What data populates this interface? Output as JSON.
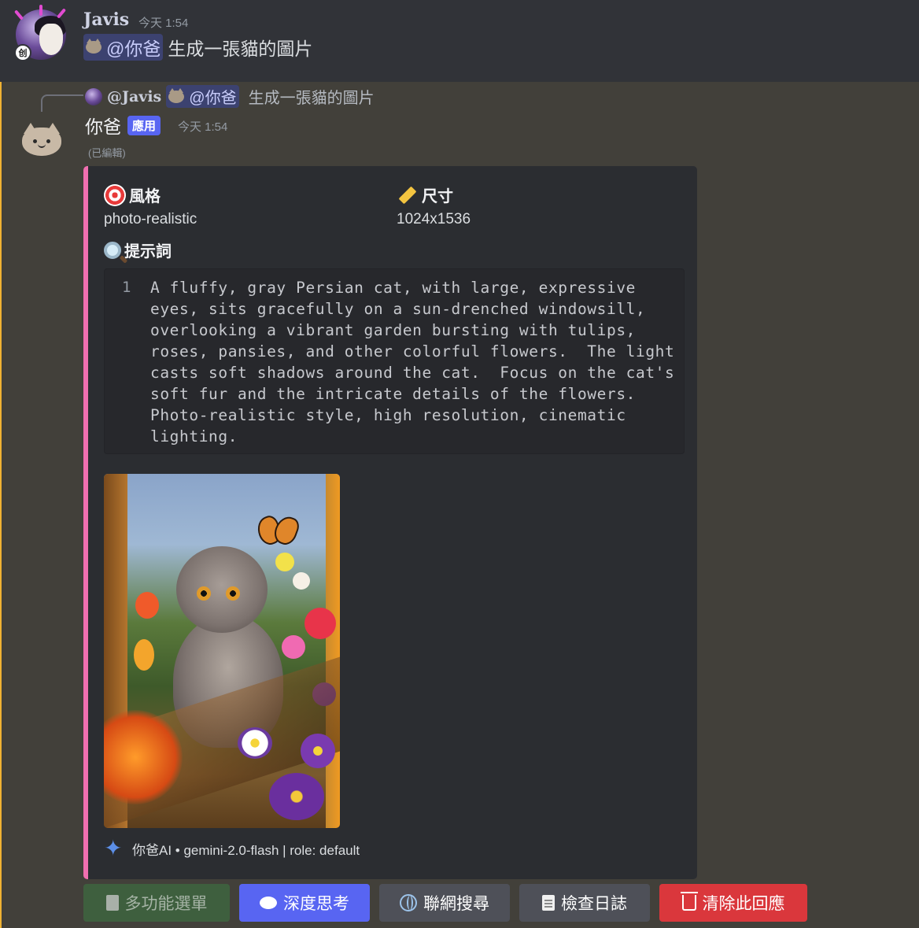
{
  "message1": {
    "author": "Javis",
    "timestamp": "今天 1:54",
    "mention": "@你爸",
    "text": "生成一張貓的圖片"
  },
  "message2": {
    "reply": {
      "author": "@Javis",
      "mention": "@你爸",
      "text": "生成一張貓的圖片"
    },
    "author": "你爸",
    "badge": "應用",
    "timestamp": "今天 1:54",
    "edited": "(已編輯)",
    "embed": {
      "accent_color": "#f06fb0",
      "fields": {
        "style_title": "風格",
        "style_value": "photo-realistic",
        "size_title": "尺寸",
        "size_value": "1024x1536",
        "prompt_title": "提示詞"
      },
      "code_line_number": "1",
      "prompt_text": "A fluffy, gray Persian cat, with large, expressive eyes, sits gracefully on a sun-drenched windowsill, overlooking a vibrant garden bursting with tulips, roses, pansies, and other colorful flowers.  The light casts soft shadows around the cat.  Focus on the cat's soft fur and the intricate details of the flowers.  Photo-realistic style, high resolution, cinematic lighting.",
      "footer": "你爸AI • gemini-2.0-flash | role: default"
    },
    "buttons": {
      "menu": "多功能選單",
      "think": "深度思考",
      "web": "聯網搜尋",
      "log": "檢查日誌",
      "clear": "清除此回應"
    }
  }
}
